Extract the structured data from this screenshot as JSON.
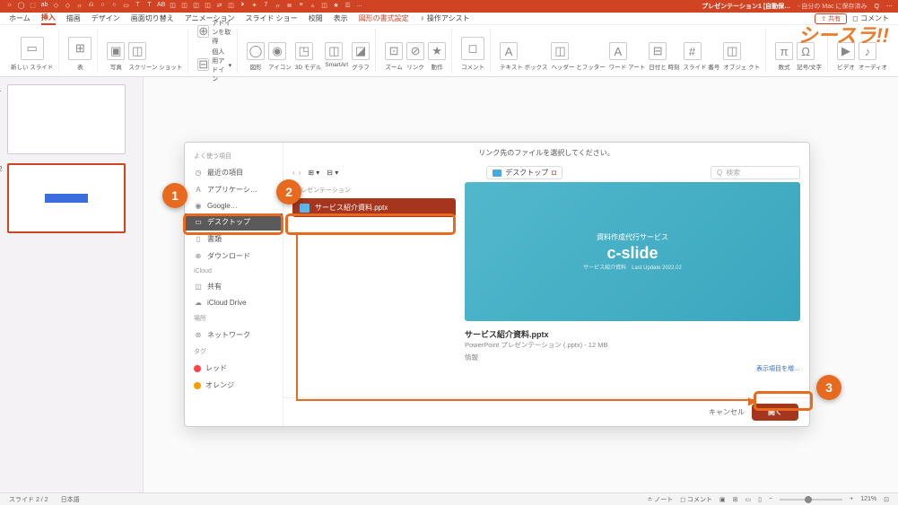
{
  "titlebar": {
    "doc_title": "プレゼンテーション1 [自動保…",
    "doc_subtitle": "- 自分の Mac に保存済み"
  },
  "menus": {
    "home": "ホーム",
    "insert": "挿入",
    "draw": "描画",
    "design": "デザイン",
    "transition": "画面切り替え",
    "animation": "アニメーション",
    "slideshow": "スライド ショー",
    "review": "校閲",
    "view": "表示",
    "shapeformat": "図形の書式設定",
    "assist": "操作アシスト",
    "share": "共有",
    "comment": "コメント"
  },
  "ribbon": {
    "newslide": "新しい\nスライド",
    "table": "表",
    "photo": "写真",
    "screenshot": "スクリーン\nショット",
    "addin1": "アドインを取得",
    "addin2": "個人用アドイン",
    "shape": "図形",
    "icon": "アイコン",
    "model3d": "3D\nモデル",
    "smartart": "SmartArt",
    "graph": "グラフ",
    "zoom": "ズーム",
    "link": "リンク",
    "action": "動作",
    "comment": "コメント",
    "textbox": "テキスト\nボックス",
    "headerfooter": "ヘッダー\nとフッター",
    "wordart": "ワード\nアート",
    "datetime": "日付と\n時刻",
    "slidenum": "スライド\n番号",
    "object": "オブジェ\nクト",
    "equation": "数式",
    "symbol": "記号/文字",
    "video": "ビデオ",
    "audio": "オーディオ"
  },
  "thumbs": {
    "n1": "1",
    "n2": "2"
  },
  "dialog": {
    "title": "リンク先のファイルを選択してください。",
    "pathlabel": "デスクトップ",
    "search_placeholder": "検索",
    "side": {
      "fav_head": "よく使う項目",
      "recent": "最近の項目",
      "apps": "アプリケーシ…",
      "google": "Google…",
      "desktop": "デスクトップ",
      "docs": "書類",
      "downloads": "ダウンロード",
      "icloud_head": "iCloud",
      "shared": "共有",
      "icloud_drive": "iCloud Drive",
      "loc_head": "場所",
      "network": "ネットワーク",
      "tag_head": "タグ",
      "red": "レッド",
      "orange": "オレンジ"
    },
    "list": {
      "head": "プレゼンテーション",
      "file1": "サービス紹介資料.pptx"
    },
    "preview": {
      "tagline": "資料作成代行サービス",
      "brand": "c-slide",
      "subline": "サービス紹介資料　Last Update 2022.02",
      "name": "サービス紹介資料.pptx",
      "meta": "PowerPoint プレゼンテーション (.pptx) - 12 MB",
      "info": "情報",
      "showmore": "表示項目を増…"
    },
    "cancel": "キャンセル",
    "open": "開く"
  },
  "callouts": {
    "c1": "1",
    "c2": "2",
    "c3": "3"
  },
  "brand": "シースラ!!",
  "status": {
    "slide": "スライド 2 / 2",
    "lang": "日本語",
    "notes": "ノート",
    "comments": "コメント",
    "zoom": "121%"
  }
}
